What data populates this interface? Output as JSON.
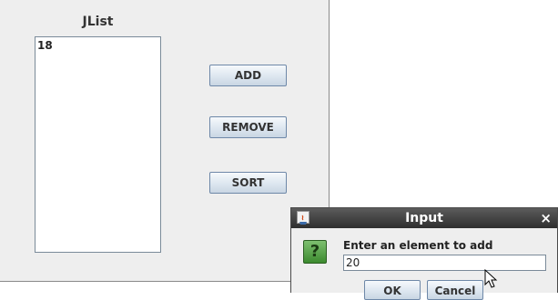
{
  "main": {
    "list_title": "JList",
    "list_items": [
      "18"
    ],
    "buttons": {
      "add": "ADD",
      "remove": "REMOVE",
      "sort": "SORT"
    }
  },
  "dialog": {
    "title": "Input",
    "close_symbol": "×",
    "question_symbol": "?",
    "prompt": "Enter an element to add",
    "input_value": "20",
    "ok_label": "OK",
    "cancel_label": "Cancel"
  },
  "icons": {
    "dialog_app": "java-icon",
    "dialog_close": "close-icon",
    "prompt": "question-icon",
    "pointer": "cursor-icon"
  },
  "colors": {
    "window_bg": "#eeeeee",
    "titlebar_dark": "#2e2e2e",
    "button_border": "#6e88a8",
    "question_green": "#3c8a2f"
  }
}
